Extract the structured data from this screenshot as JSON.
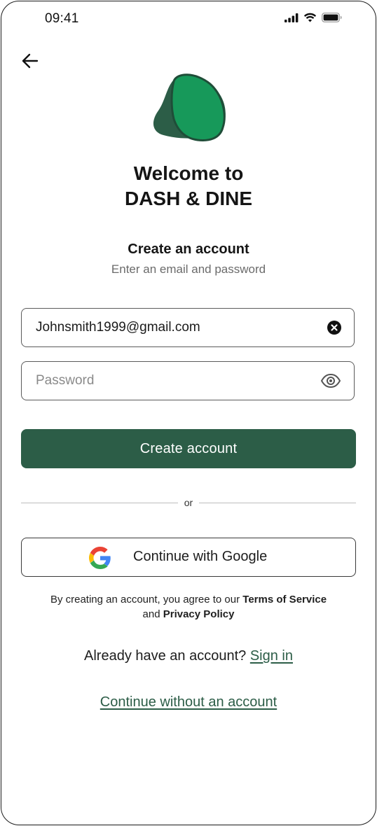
{
  "status_bar": {
    "time": "09:41",
    "icons": [
      "cellular-signal-icon",
      "wifi-icon",
      "battery-icon"
    ]
  },
  "nav": {
    "back_icon": "arrow-left-icon"
  },
  "brand": {
    "logo_icon": "avocado-logo-icon",
    "welcome_line1": "Welcome to",
    "welcome_line2": "DASH & DINE",
    "primary_color": "#2c5d47",
    "logo_light_color": "#17995a"
  },
  "form": {
    "title": "Create an account",
    "subtitle": "Enter an email and password",
    "email": {
      "value": "Johnsmith1999@gmail.com",
      "clear_icon": "clear-x-icon"
    },
    "password": {
      "placeholder": "Password",
      "value": "",
      "toggle_icon": "eye-icon"
    },
    "submit_label": "Create account"
  },
  "divider": {
    "label": "or"
  },
  "google": {
    "icon": "google-icon",
    "label": "Continue with Google"
  },
  "terms": {
    "prefix": "By creating an account, you agree to our ",
    "terms_link": "Terms of Service",
    "middle": "and ",
    "privacy_link": "Privacy Policy"
  },
  "signin": {
    "prompt": "Already have an account? ",
    "link": "Sign in"
  },
  "guest": {
    "link": "Continue without an account"
  }
}
